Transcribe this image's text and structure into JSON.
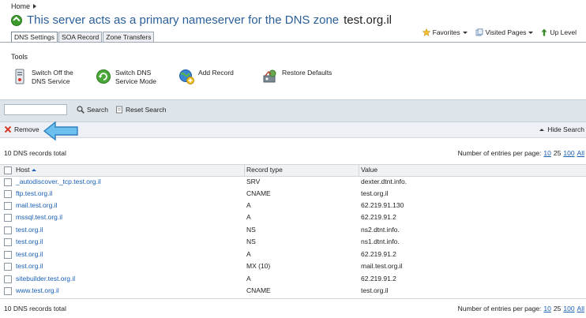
{
  "breadcrumb": {
    "home": "Home"
  },
  "page": {
    "title": "This server acts as a primary nameserver for the DNS zone",
    "zone": "test.org.il"
  },
  "tabs": [
    {
      "label": "DNS Settings",
      "active": true
    },
    {
      "label": "SOA Record",
      "active": false
    },
    {
      "label": "Zone Transfers",
      "active": false
    }
  ],
  "top_actions": {
    "favorites": "Favorites",
    "visited": "Visited Pages",
    "up_level": "Up Level"
  },
  "tools": {
    "heading": "Tools",
    "switch_off": {
      "line1": "Switch Off the",
      "line2": "DNS Service"
    },
    "switch_mode": {
      "line1": "Switch DNS",
      "line2": "Service Mode"
    },
    "add_record": "Add Record",
    "restore": "Restore Defaults"
  },
  "search": {
    "value": "",
    "search_label": "Search",
    "reset_label": "Reset Search"
  },
  "actions": {
    "remove": "Remove",
    "hide_search": "Hide Search"
  },
  "summary": {
    "total": "10 DNS records total",
    "per_page_label": "Number of entries per page:",
    "per_page_options": [
      "10",
      "25",
      "100",
      "All"
    ],
    "per_page_selected": "25"
  },
  "table": {
    "columns": {
      "host": "Host",
      "type": "Record type",
      "value": "Value"
    },
    "rows": [
      {
        "host": "_autodiscover._tcp.test.org.il",
        "type": "SRV",
        "value": "dexter.dtnt.info."
      },
      {
        "host": "ftp.test.org.il",
        "type": "CNAME",
        "value": "test.org.il"
      },
      {
        "host": "mail.test.org.il",
        "type": "A",
        "value": "62.219.91.130"
      },
      {
        "host": "mssql.test.org.il",
        "type": "A",
        "value": "62.219.91.2"
      },
      {
        "host": "test.org.il",
        "type": "NS",
        "value": "ns2.dtnt.info."
      },
      {
        "host": "test.org.il",
        "type": "NS",
        "value": "ns1.dtnt.info."
      },
      {
        "host": "test.org.il",
        "type": "A",
        "value": "62.219.91.2"
      },
      {
        "host": "test.org.il",
        "type": "MX (10)",
        "value": "mail.test.org.il"
      },
      {
        "host": "sitebuilder.test.org.il",
        "type": "A",
        "value": "62.219.91.2"
      },
      {
        "host": "www.test.org.il",
        "type": "CNAME",
        "value": "test.org.il"
      }
    ]
  },
  "colors": {
    "link": "#1a5fb4",
    "title": "#2a5f9a",
    "band": "#dde4ea",
    "arrow": "#5fb4e8"
  }
}
